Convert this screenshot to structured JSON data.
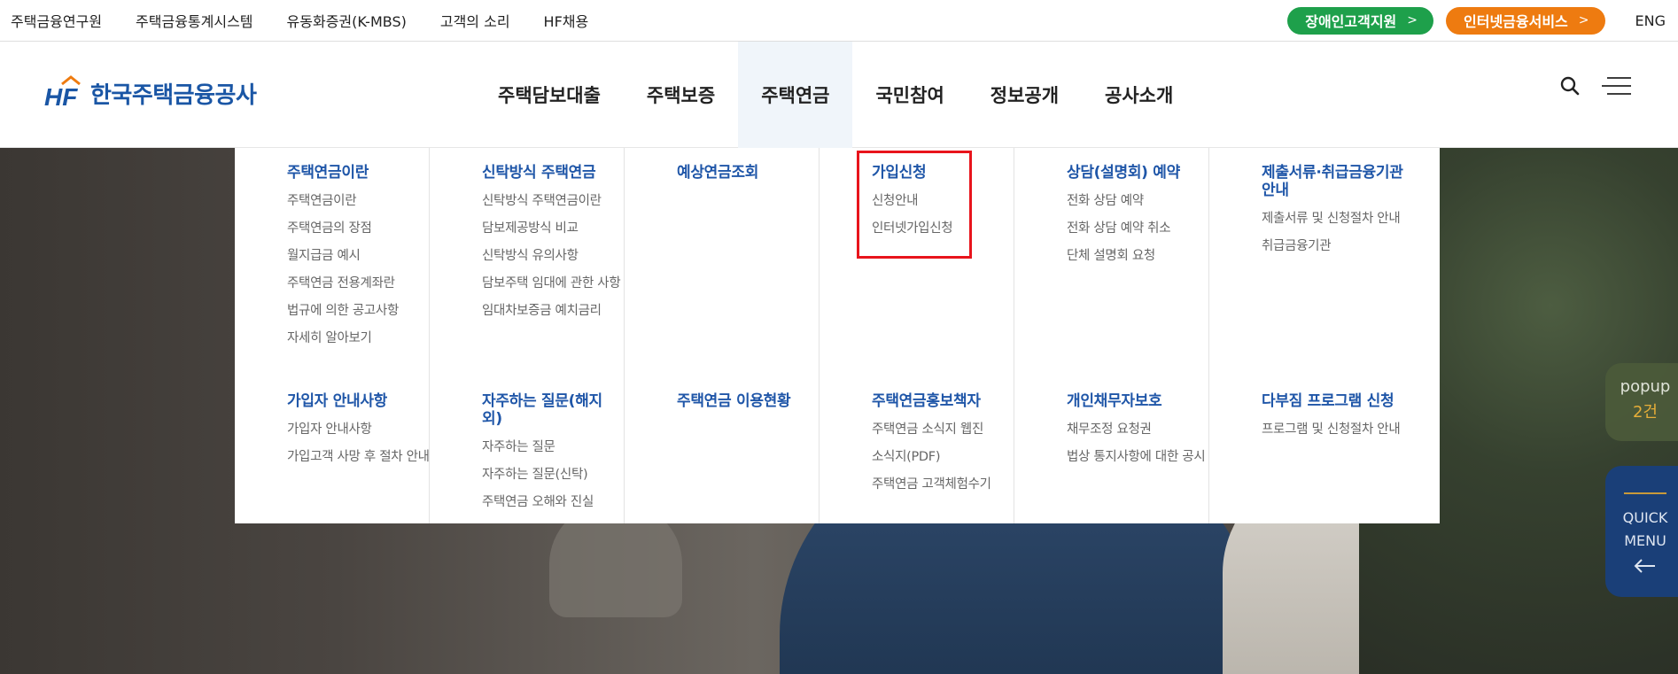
{
  "topbar": {
    "links": [
      "주택금융연구원",
      "주택금융통계시스템",
      "유동화증권(K-MBS)",
      "고객의 소리",
      "HF채용"
    ],
    "accessibility_label": "장애인고객지원",
    "internet_service_label": "인터넷금융서비스",
    "chevron": ">",
    "lang_label": "ENG"
  },
  "brand": {
    "mark_text": "HF",
    "name": "한국주택금융공사",
    "color_primary": "#1a56a5",
    "color_accent": "#ee7b10",
    "color_green": "#1ea04b"
  },
  "gnb": {
    "items": [
      "주택담보대출",
      "주택보증",
      "주택연금",
      "국민참여",
      "정보공개",
      "공사소개"
    ],
    "active_index": 2
  },
  "header_icons": {
    "search": "search-icon",
    "menu": "hamburger-menu-icon"
  },
  "mega": {
    "columns": [
      {
        "top": {
          "title": "주택연금이란",
          "items": [
            "주택연금이란",
            "주택연금의 장점",
            "월지급금 예시",
            "주택연금 전용계좌란",
            "법규에 의한 공고사항",
            "자세히 알아보기"
          ]
        },
        "bottom": {
          "title": "가입자 안내사항",
          "items": [
            "가입자 안내사항",
            "가입고객 사망 후 절차 안내"
          ]
        }
      },
      {
        "top": {
          "title": "신탁방식 주택연금",
          "items": [
            "신탁방식 주택연금이란",
            "담보제공방식 비교",
            "신탁방식 유의사항",
            "담보주택 임대에 관한 사항",
            "임대차보증금 예치금리"
          ]
        },
        "bottom": {
          "title": "자주하는 질문(해지 외)",
          "items": [
            "자주하는 질문",
            "자주하는 질문(신탁)",
            "주택연금 오해와 진실"
          ]
        }
      },
      {
        "top": {
          "title": "예상연금조회",
          "items": []
        },
        "bottom": {
          "title": "주택연금 이용현황",
          "items": []
        }
      },
      {
        "top": {
          "title": "가입신청",
          "items": [
            "신청안내",
            "인터넷가입신청"
          ]
        },
        "bottom": {
          "title": "주택연금홍보책자",
          "items": [
            "주택연금 소식지 웹진",
            "소식지(PDF)",
            "주택연금 고객체험수기"
          ]
        }
      },
      {
        "top": {
          "title": "상담(설명회) 예약",
          "items": [
            "전화 상담 예약",
            "전화 상담 예약 취소",
            "단체 설명회 요청"
          ]
        },
        "bottom": {
          "title": "개인채무자보호",
          "items": [
            "채무조정 요청권",
            "법상 통지사항에 대한 공시"
          ]
        }
      },
      {
        "top": {
          "title": "제출서류·취급금융기관 안내",
          "items": [
            "제출서류 및 신청절차 안내",
            "취급금융기관"
          ]
        },
        "bottom": {
          "title": "다부짐 프로그램 신청",
          "items": [
            "프로그램 및 신청절차 안내"
          ]
        }
      }
    ],
    "highlight_color": "#e8141c"
  },
  "floating": {
    "popup_label": "popup",
    "popup_count": "2건",
    "quick_label": "QUICK MENU"
  }
}
